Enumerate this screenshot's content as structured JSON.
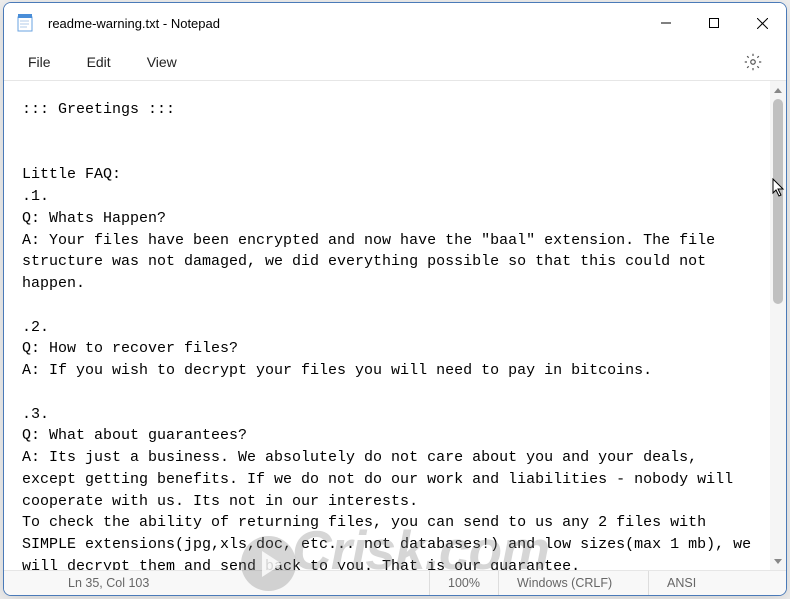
{
  "titlebar": {
    "title": "readme-warning.txt - Notepad"
  },
  "menubar": {
    "file": "File",
    "edit": "Edit",
    "view": "View"
  },
  "document": {
    "line1": "::: Greetings :::",
    "line2": "",
    "line3": "",
    "line4": "Little FAQ:",
    "line5": ".1.",
    "line6": "Q: Whats Happen?",
    "line7": "A: Your files have been encrypted and now have the \"baal\" extension. The file structure was not damaged, we did everything possible so that this could not happen.",
    "line8": "",
    "line9": ".2.",
    "line10": "Q: How to recover files?",
    "line11": "A: If you wish to decrypt your files you will need to pay in bitcoins.",
    "line12": "",
    "line13": ".3.",
    "line14": "Q: What about guarantees?",
    "line15": "A: Its just a business. We absolutely do not care about you and your deals, except getting benefits. If we do not do our work and liabilities - nobody will cooperate with us. Its not in our interests.",
    "line16": "To check the ability of returning files, you can send to us any 2 files with SIMPLE extensions(jpg,xls,doc, etc... not databases!) and low sizes(max 1 mb), we will decrypt them and send back to you. That is our guarantee."
  },
  "statusbar": {
    "position": "Ln 35, Col 103",
    "zoom": "100%",
    "eol": "Windows (CRLF)",
    "encoding": "ANSI"
  },
  "watermark": {
    "text": "Crisk.com"
  }
}
